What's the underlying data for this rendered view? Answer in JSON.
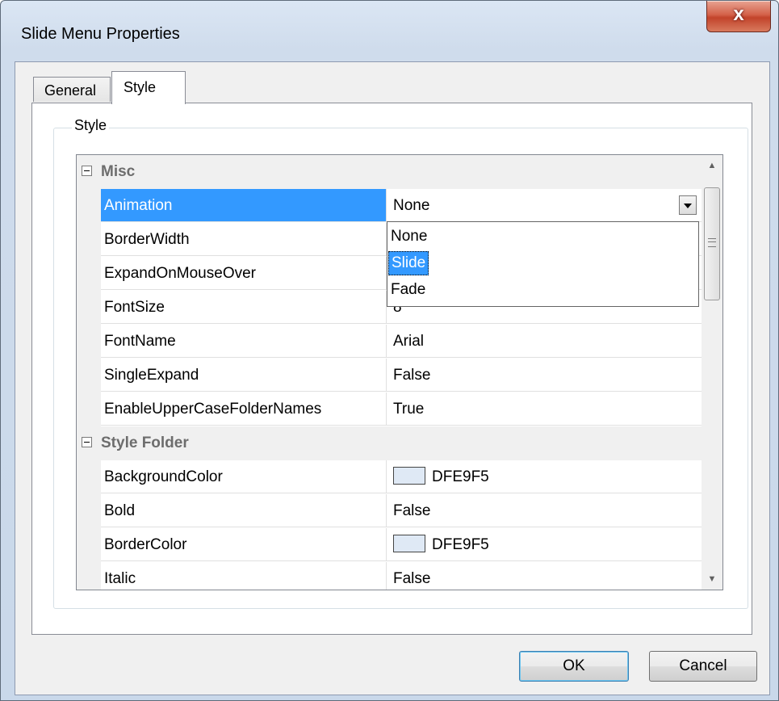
{
  "window": {
    "title": "Slide Menu Properties",
    "close_label": "x"
  },
  "tabs": [
    {
      "label": "General",
      "active": false
    },
    {
      "label": "Style",
      "active": true
    }
  ],
  "groupbox": {
    "label": "Style"
  },
  "property_grid": {
    "categories": [
      {
        "name": "Misc",
        "properties": [
          {
            "name": "Animation",
            "value": "None",
            "selected": true,
            "editor": "dropdown"
          },
          {
            "name": "BorderWidth",
            "value": ""
          },
          {
            "name": "ExpandOnMouseOver",
            "value": ""
          },
          {
            "name": "FontSize",
            "value": "8"
          },
          {
            "name": "FontName",
            "value": "Arial"
          },
          {
            "name": "SingleExpand",
            "value": "False"
          },
          {
            "name": "EnableUpperCaseFolderNames",
            "value": "True"
          }
        ]
      },
      {
        "name": "Style Folder",
        "properties": [
          {
            "name": "BackgroundColor",
            "value": "DFE9F5",
            "color": "#DFE9F5"
          },
          {
            "name": "Bold",
            "value": "False"
          },
          {
            "name": "BorderColor",
            "value": "DFE9F5",
            "color": "#DFE9F5"
          },
          {
            "name": "Italic",
            "value": "False"
          }
        ]
      }
    ],
    "dropdown_options": [
      "None",
      "Slide",
      "Fade"
    ],
    "dropdown_highlighted": "Slide"
  },
  "buttons": {
    "ok": "OK",
    "cancel": "Cancel"
  },
  "colors": {
    "selection": "#3399ff",
    "close_button": "#c2432a",
    "frame": "#c9d8ea"
  }
}
